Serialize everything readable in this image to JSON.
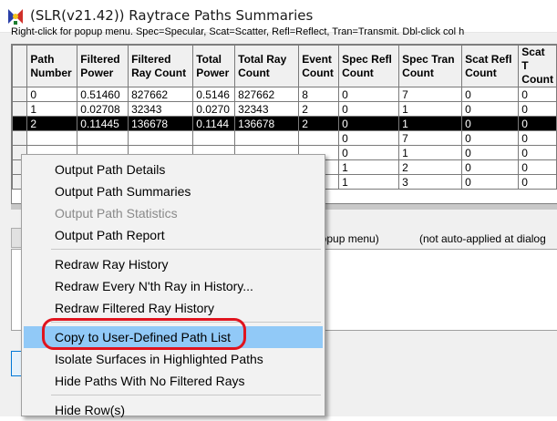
{
  "window": {
    "title": "(SLR(v21.42)) Raytrace Paths Summaries",
    "icon": "app-logo-icon"
  },
  "help_text": "Right-click for popup menu.  Spec=Specular, Scat=Scatter,  Refl=Reflect, Tran=Transmit.  Dbl-click col h",
  "grid": {
    "columns": [
      "Path Number",
      "Filtered Power",
      "Filtered Ray Count",
      "Total Power",
      "Total Ray Count",
      "Event Count",
      "Spec Refl Count",
      "Spec Tran Count",
      "Scat Refl Count",
      "Scat T Count"
    ],
    "rows": [
      [
        "0",
        "0.51460",
        "827662",
        "0.5146",
        "827662",
        "8",
        "0",
        "7",
        "0",
        "0"
      ],
      [
        "1",
        "0.02708",
        "32343",
        "0.0270",
        "32343",
        "2",
        "0",
        "1",
        "0",
        "0"
      ],
      [
        "2",
        "0.11445",
        "136678",
        "0.1144",
        "136678",
        "2",
        "0",
        "1",
        "0",
        "0"
      ],
      [
        "",
        "",
        "",
        "",
        "",
        "",
        "0",
        "7",
        "0",
        "0"
      ],
      [
        "",
        "",
        "",
        "",
        "",
        "",
        "0",
        "1",
        "0",
        "0"
      ],
      [
        "",
        "",
        "",
        "",
        "",
        "",
        "1",
        "2",
        "0",
        "0"
      ],
      [
        "",
        "",
        "",
        "",
        "",
        "",
        "1",
        "3",
        "0",
        "0"
      ]
    ],
    "selected_row": 2
  },
  "lower_area": {
    "popup_hint": "popup menu)",
    "auto_note": "(not auto-applied at dialog"
  },
  "context_menu": {
    "groups": [
      [
        {
          "label": "Output Path Details",
          "disabled": false
        },
        {
          "label": "Output Path Summaries",
          "disabled": false
        },
        {
          "label": "Output Path Statistics",
          "disabled": true
        },
        {
          "label": "Output Path Report",
          "disabled": false
        }
      ],
      [
        {
          "label": "Redraw Ray History",
          "disabled": false
        },
        {
          "label": "Redraw Every N'th Ray in History...",
          "disabled": false
        },
        {
          "label": "Redraw Filtered Ray History",
          "disabled": false
        }
      ],
      [
        {
          "label": "Copy to User-Defined Path List",
          "disabled": false,
          "highlighted": true
        },
        {
          "label": "Isolate Surfaces in Highlighted Paths",
          "disabled": false
        },
        {
          "label": "Hide Paths With No Filtered Rays",
          "disabled": false
        }
      ],
      [
        {
          "label": "Hide Row(s)",
          "disabled": false
        }
      ]
    ]
  },
  "colors": {
    "highlight": "#91c9f7",
    "callout": "#e0141e",
    "selected_row": "#000000"
  }
}
